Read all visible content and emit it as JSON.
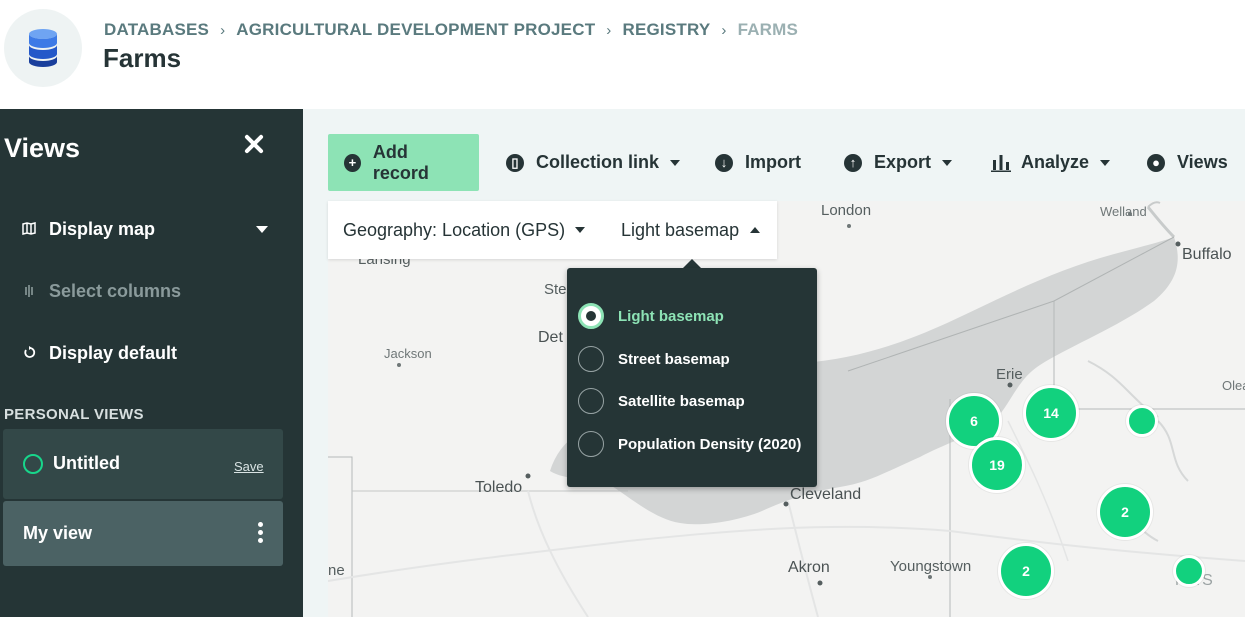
{
  "breadcrumb": {
    "items": [
      "DATABASES",
      "AGRICULTURAL DEVELOPMENT PROJECT",
      "REGISTRY",
      "FARMS"
    ],
    "separator": "›"
  },
  "page": {
    "title": "Farms"
  },
  "sidebar": {
    "title": "Views",
    "display_map": "Display map",
    "select_columns": "Select columns",
    "display_default": "Display default",
    "section_label": "PERSONAL VIEWS",
    "views": [
      {
        "name": "Untitled",
        "action": "Save"
      },
      {
        "name": "My view"
      }
    ]
  },
  "toolbar": {
    "add_record": "Add record",
    "collection_link": "Collection link",
    "import": "Import",
    "export": "Export",
    "analyze": "Analyze",
    "views": "Views"
  },
  "map_controls": {
    "geography": "Geography: Location (GPS)",
    "basemap": "Light basemap"
  },
  "basemap_options": [
    {
      "label": "Light basemap",
      "selected": true
    },
    {
      "label": "Street basemap",
      "selected": false
    },
    {
      "label": "Satellite basemap",
      "selected": false
    },
    {
      "label": "Population Density (2020)",
      "selected": false
    }
  ],
  "map": {
    "cities": [
      "London",
      "Welland",
      "Buffalo",
      "Lansing",
      "Ste",
      "Det",
      "Jackson",
      "Erie",
      "Olea",
      "Toledo",
      "Cleveland",
      "Akron",
      "Youngstown",
      "ne",
      "NNS"
    ],
    "clusters": [
      "6",
      "14",
      "",
      "19",
      "2",
      "2",
      ""
    ]
  },
  "colors": {
    "sidebar": "#253536",
    "accent": "#8de3b5",
    "cluster": "#12d17e",
    "water": "#d3d5d5"
  }
}
